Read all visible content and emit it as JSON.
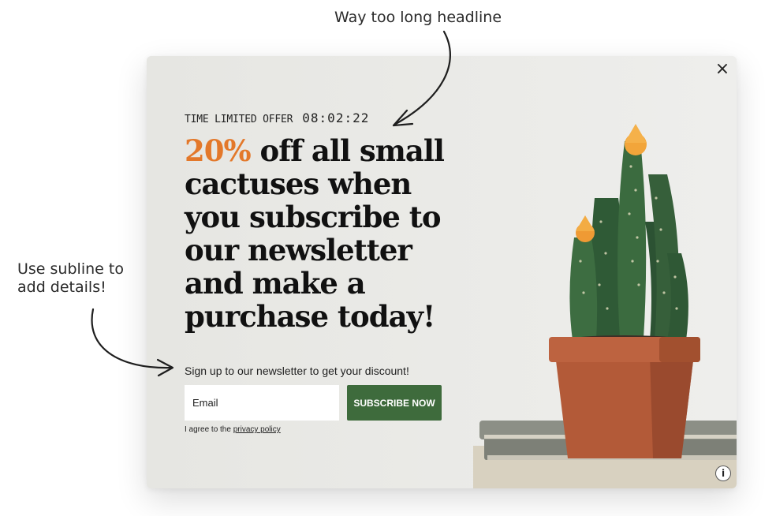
{
  "annotations": {
    "top": "Way too long headline",
    "left": "Use subline to add details!"
  },
  "popup": {
    "close_icon": "×",
    "offer_label": "TIME LIMITED OFFER",
    "timer": "08:02:22",
    "headline_accent": "20%",
    "headline_rest": " off all small cactuses when you subscribe to our newsletter and make a purchase today!",
    "subline": "Sign up to our newsletter to get your discount!",
    "email_placeholder": "Email",
    "button_label": "SUBSCRIBE NOW",
    "consent_prefix": "I agree to the ",
    "consent_link": "privacy policy",
    "info_icon": "i",
    "colors": {
      "accent": "#e3782a",
      "button": "#3e6b3c",
      "background": "#e9e9e6"
    }
  }
}
